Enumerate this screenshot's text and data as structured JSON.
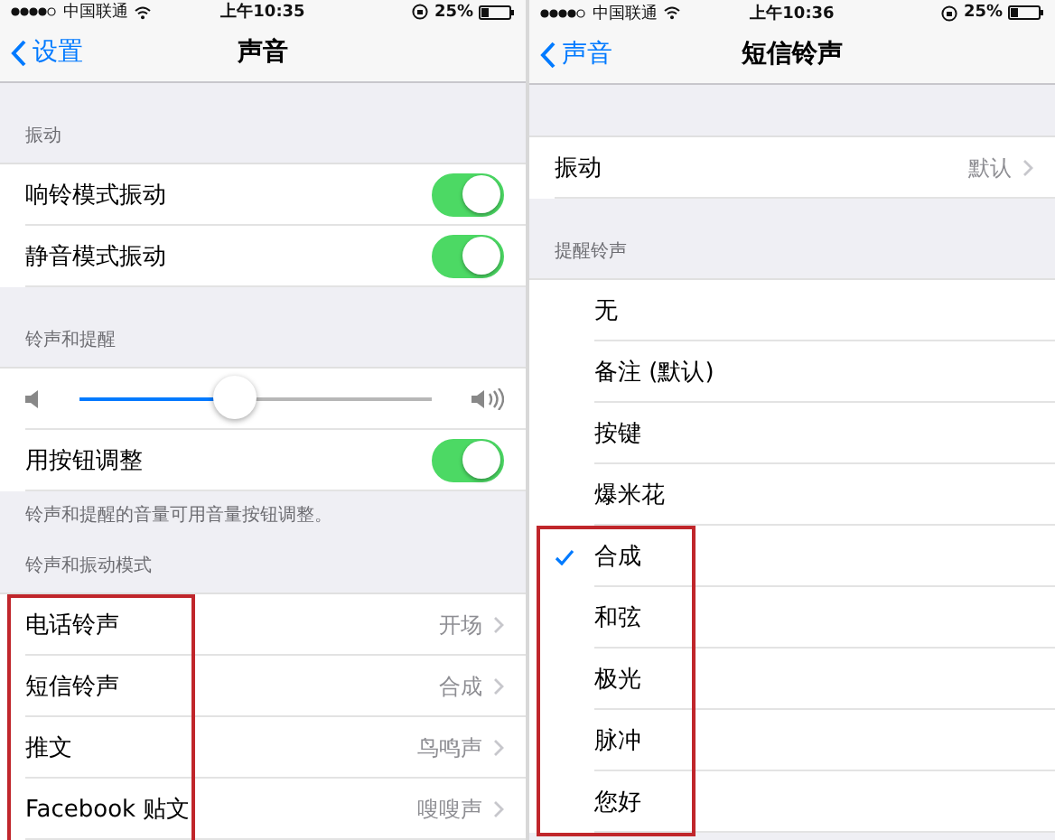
{
  "panels": [
    {
      "status_bar": {
        "carrier": "中国联通",
        "time": "上午10:35",
        "battery": "25%"
      },
      "nav": {
        "back": "设置",
        "title": "声音"
      },
      "sections": [
        {
          "header": "振动",
          "rows": [
            {
              "kind": "toggle",
              "label": "响铃模式振动",
              "on": true,
              "highlighted": false
            },
            {
              "kind": "toggle",
              "label": "静音模式振动",
              "on": true,
              "highlighted": false
            }
          ]
        },
        {
          "header": "铃声和提醒",
          "footer": "铃声和提醒的音量可用音量按钮调整。",
          "rows": [
            {
              "kind": "slider",
              "level": 0.44,
              "highlighted": false
            },
            {
              "kind": "toggle",
              "label": "用按钮调整",
              "on": true,
              "highlighted": false
            }
          ]
        },
        {
          "header": "铃声和振动模式",
          "rows": [
            {
              "kind": "detail",
              "label": "电话铃声",
              "value": "开场",
              "highlighted": true
            },
            {
              "kind": "detail",
              "label": "短信铃声",
              "value": "合成",
              "highlighted": true
            },
            {
              "kind": "detail",
              "label": "推文",
              "value": "鸟鸣声",
              "highlighted": true
            },
            {
              "kind": "detail",
              "label": "Facebook 贴文",
              "value": "嗖嗖声",
              "highlighted": true
            }
          ]
        }
      ]
    },
    {
      "status_bar": {
        "carrier": "中国联通",
        "time": "上午10:36",
        "battery": "25%"
      },
      "nav": {
        "back": "声音",
        "title": "短信铃声"
      },
      "sections": [
        {
          "rows": [
            {
              "kind": "detail",
              "label": "振动",
              "value": "默认",
              "highlighted": false
            }
          ]
        },
        {
          "header": "提醒铃声",
          "rows": [
            {
              "kind": "choice",
              "label": "无",
              "selected": false,
              "highlighted": false
            },
            {
              "kind": "choice",
              "label": "备注 (默认)",
              "selected": false,
              "highlighted": false
            },
            {
              "kind": "choice",
              "label": "按键",
              "selected": false,
              "highlighted": false
            },
            {
              "kind": "choice",
              "label": "爆米花",
              "selected": false,
              "highlighted": false
            },
            {
              "kind": "choice",
              "label": "合成",
              "selected": true,
              "highlighted": true
            },
            {
              "kind": "choice",
              "label": "和弦",
              "selected": false,
              "highlighted": true
            },
            {
              "kind": "choice",
              "label": "极光",
              "selected": false,
              "highlighted": true
            },
            {
              "kind": "choice",
              "label": "脉冲",
              "selected": false,
              "highlighted": true
            },
            {
              "kind": "choice",
              "label": "您好",
              "selected": false,
              "highlighted": true
            }
          ]
        }
      ]
    }
  ]
}
